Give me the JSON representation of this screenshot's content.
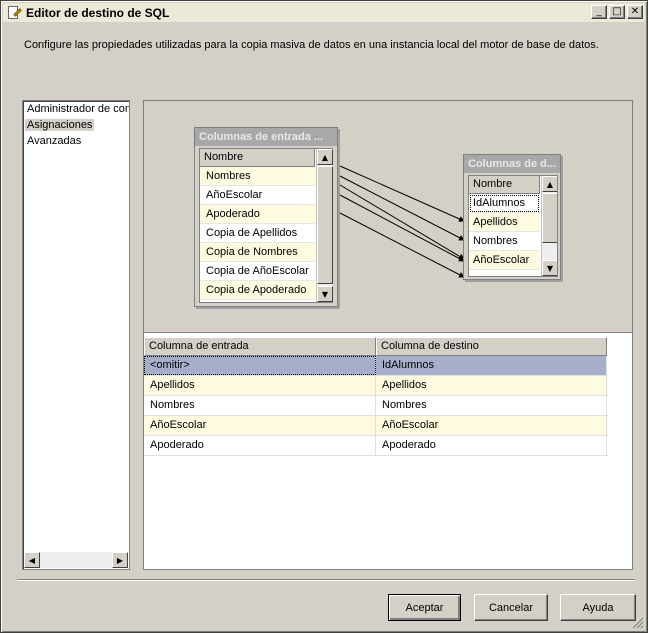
{
  "window": {
    "title": "Editor de destino de SQL",
    "controls": {
      "minimize": "_",
      "maximize": "□",
      "close": "✕"
    }
  },
  "description": "Configure las propiedades utilizadas para la copia masiva de datos en una instancia local del motor de base de datos.",
  "sidebar": {
    "items": [
      {
        "label": "Administrador de conexiones",
        "selected": false
      },
      {
        "label": "Asignaciones",
        "selected": true
      },
      {
        "label": "Avanzadas",
        "selected": false
      }
    ]
  },
  "input_table": {
    "title": "Columnas de entrada ...",
    "column_header": "Nombre",
    "rows": [
      "Nombres",
      "AñoEscolar",
      "Apoderado",
      "Copia de Apellidos",
      "Copia de Nombres",
      "Copia de AñoEscolar",
      "Copia de Apoderado"
    ]
  },
  "dest_table": {
    "title": "Columnas de d...",
    "column_header": "Nombre",
    "rows": [
      "IdAlumnos",
      "Apellidos",
      "Nombres",
      "AñoEscolar"
    ]
  },
  "mapping_grid": {
    "headers": [
      "Columna de entrada",
      "Columna de destino"
    ],
    "rows": [
      {
        "input": "<omitir>",
        "destination": "IdAlumnos",
        "selected": true
      },
      {
        "input": "Apellidos",
        "destination": "Apellidos"
      },
      {
        "input": "Nombres",
        "destination": "Nombres"
      },
      {
        "input": "AñoEscolar",
        "destination": "AñoEscolar"
      },
      {
        "input": "Apoderado",
        "destination": "Apoderado"
      }
    ]
  },
  "buttons": {
    "ok": "Aceptar",
    "cancel": "Cancelar",
    "help": "Ayuda"
  },
  "colors": {
    "dialog_bg": "#d4d0c8",
    "selected_row": "#a6aec9",
    "alt_row": "#fffbe0"
  }
}
